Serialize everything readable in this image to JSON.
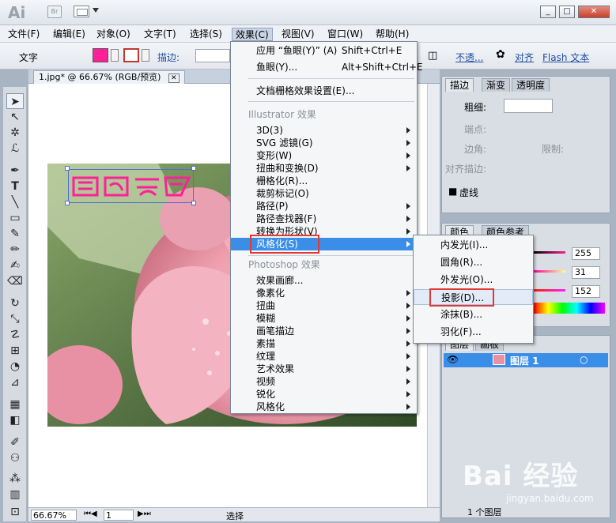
{
  "app": {
    "logo": "Ai",
    "bridge": "Br"
  },
  "menubar": [
    "文件(F)",
    "编辑(E)",
    "对象(O)",
    "文字(T)",
    "选择(S)",
    "效果(C)",
    "视图(V)",
    "窗口(W)",
    "帮助(H)"
  ],
  "control": {
    "mode": "文字",
    "stroke_label": "描边:",
    "opacity": "不透...",
    "align": "对齐",
    "flash": "Flash 文本"
  },
  "document": {
    "tab": "1.jpg* @ 66.67% (RGB/预览)",
    "zoom": "66.67%",
    "page": "1",
    "status": "选择"
  },
  "effect_menu": {
    "apply": "应用 “鱼眼(Y)” (A)",
    "apply_sc": "Shift+Ctrl+E",
    "fisheye": "鱼眼(Y)...",
    "fisheye_sc": "Alt+Shift+Ctrl+E",
    "raster_settings": "文档栅格效果设置(E)...",
    "illustrator_group": "Illustrator 效果",
    "illustrator_items": [
      "3D(3)",
      "SVG 滤镜(G)",
      "变形(W)",
      "扭曲和变换(D)",
      "栅格化(R)...",
      "裁剪标记(O)",
      "路径(P)",
      "路径查找器(F)",
      "转换为形状(V)",
      "风格化(S)"
    ],
    "photoshop_group": "Photoshop 效果",
    "photoshop_items": [
      "效果画廊...",
      "像素化",
      "扭曲",
      "模糊",
      "画笔描边",
      "素描",
      "纹理",
      "艺术效果",
      "视频",
      "锐化",
      "风格化"
    ]
  },
  "stylize_submenu": [
    "内发光(I)...",
    "圆角(R)...",
    "外发光(O)...",
    "投影(D)...",
    "涂抹(B)...",
    "羽化(F)..."
  ],
  "stroke_panel": {
    "tabs": [
      "描边",
      "渐变",
      "透明度"
    ],
    "weight": "粗细:",
    "cap": "端点:",
    "corner": "边角:",
    "limit": "限制:",
    "align": "对齐描边:",
    "dashed": "虚线"
  },
  "color_panel": {
    "tabs": [
      "颜色",
      "颜色参考"
    ],
    "values": [
      "255",
      "31",
      "152"
    ]
  },
  "layers_panel": {
    "tabs": [
      "图层",
      "画板"
    ],
    "layer": "图层 1",
    "count": "1 个图层"
  },
  "watermark": {
    "brand": "Bai 经验",
    "url": "jingyan.baidu.com"
  },
  "colors": {
    "accent": "#3b8ee8",
    "highlight_box": "#e03a33",
    "fill": "#ff1f98"
  }
}
